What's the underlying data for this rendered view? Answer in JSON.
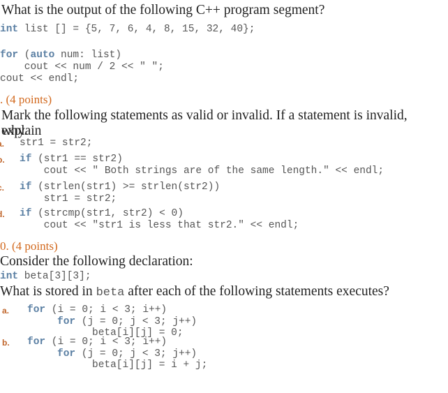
{
  "q1": {
    "prompt": "What is the output of the following C++ program segment?",
    "code": [
      {
        "kw": "int",
        "rest": " list [] = {5, 7, 6, 4, 8, 15, 32, 40};"
      },
      {
        "kw": "for",
        "rest": " (",
        "kw2": "auto",
        "rest2": " num: list)"
      },
      {
        "text": "    cout << num / 2 << \" \";"
      },
      {
        "text": "cout << endl;"
      }
    ]
  },
  "q2": {
    "points": ". (4 points)",
    "prompt_line1": "Mark the following statements as valid or invalid. If a statement is invalid, explain",
    "prompt_line2": "why.",
    "items": [
      {
        "label": "a.",
        "lines": [
          {
            "text": "str1 = str2;"
          }
        ]
      },
      {
        "label": "b.",
        "lines": [
          {
            "kw": "if",
            "rest": " (str1 == str2)"
          },
          {
            "text": "    cout << \" Both strings are of the same length.\" << endl;"
          }
        ]
      },
      {
        "label": "c.",
        "lines": [
          {
            "kw": "if",
            "rest": " (strlen(str1) >= strlen(str2))"
          },
          {
            "text": "    str1 = str2;"
          }
        ]
      },
      {
        "label": "d.",
        "lines": [
          {
            "kw": "if",
            "rest": " (strcmp(str1, str2) < 0)"
          },
          {
            "text": "    cout << \"str1 is less that str2.\" << endl;"
          }
        ]
      }
    ]
  },
  "q3": {
    "points": "0. (4 points)",
    "prompt1": "Consider the following declaration:",
    "decl_kw": "int",
    "decl_rest": " beta[3][3];",
    "prompt2_before": "What is stored in ",
    "prompt2_code": "beta",
    "prompt2_after": " after each of the following statements executes?",
    "items": [
      {
        "label": "a.",
        "line1_kw": "for",
        "line1_rest": " (i = 0; i < 3; i++)",
        "line2_kw": "for",
        "line2_rest": " (j = 0; j < 3; j++)",
        "line3": "beta[i][j] = 0;"
      },
      {
        "label": "b.",
        "line1_kw": "for",
        "line1_rest": " (i = 0; i < 3; i++)",
        "line2_kw": "for",
        "line2_rest": " (j = 0; j < 3; j++)",
        "line3": "beta[i][j] = i + j;"
      }
    ]
  }
}
